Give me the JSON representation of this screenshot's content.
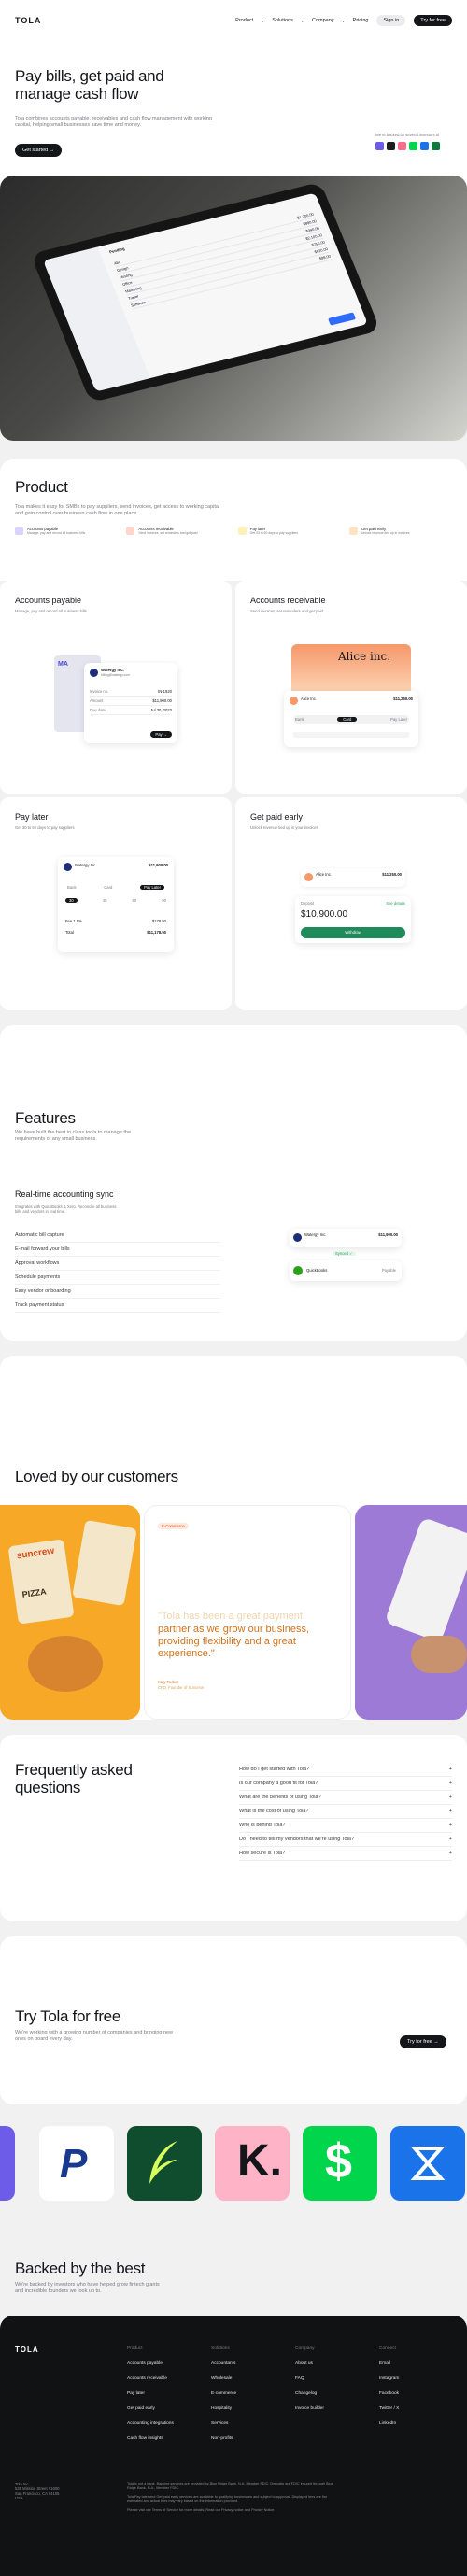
{
  "nav": {
    "logo": "TOLA",
    "links": [
      "Product",
      "Solutions",
      "Company",
      "Pricing"
    ],
    "sign_in": "Sign in",
    "cta": "Try for free"
  },
  "hero": {
    "title": "Pay bills, get paid and manage cash flow",
    "subtitle": "Tola combines accounts payable, receivables and cash flow management with working capital, helping small businesses save time and money.",
    "cta": "Get started",
    "backed": "We're backed by several investors of"
  },
  "dashboard": {
    "tab": "Pending",
    "rows": [
      [
        "Abc",
        "$1,200.00"
      ],
      [
        "Design",
        "$890.00"
      ],
      [
        "Hosting",
        "$340.00"
      ],
      [
        "Office",
        "$2,100.00"
      ],
      [
        "Marketing",
        "$750.00"
      ],
      [
        "Travel",
        "$420.00"
      ],
      [
        "Software",
        "$99.00"
      ]
    ]
  },
  "product": {
    "title": "Product",
    "subtitle": "Tola makes it easy for SMBs to pay suppliers, send invoices, get access to working capital and gain control over business cash flow in one place.",
    "chips": [
      {
        "label": "Accounts payable",
        "desc": "Manage, pay and record all business bills"
      },
      {
        "label": "Accounts receivable",
        "desc": "Send invoices, set reminders and get paid"
      },
      {
        "label": "Pay later",
        "desc": "Get 30 to 60 days to pay suppliers"
      },
      {
        "label": "Get paid early",
        "desc": "Unlock revenue tied up in invoices"
      }
    ],
    "ap": {
      "title": "Accounts payable",
      "desc": "Manage, pay and record all business bills",
      "vendor": "Watergy Inc.",
      "email": "billing@watergy.com",
      "fields": [
        [
          "Invoice no.",
          "IN-1920"
        ],
        [
          "Amount",
          "$11,900.00"
        ],
        [
          "Due date",
          "Jul 30, 2023"
        ]
      ],
      "pay": "Pay"
    },
    "ar": {
      "title": "Accounts receivable",
      "desc": "Send invoices, set reminders and get paid",
      "brand": "Alice inc.",
      "name": "Alice Inc.",
      "amount": "$11,250.00",
      "tabs": [
        "Bank",
        "Card",
        "Pay Later"
      ]
    },
    "pl": {
      "title": "Pay later",
      "desc": "Get 30 to 60 days to pay suppliers",
      "vendor": "Watergy Inc.",
      "amount": "$11,900.00",
      "tabs": [
        "Bank",
        "Card",
        "Pay Later"
      ],
      "days": [
        "30",
        "45",
        "60",
        "90"
      ],
      "fee_label": "Fee 1.5%",
      "fee": "$178.50",
      "total_label": "Total",
      "total": "$11,178.50"
    },
    "gpe": {
      "title": "Get paid early",
      "desc": "Unlock revenue tied up in your invoices",
      "vendor": "Alice Inc.",
      "amount": "$11,250.00",
      "label": "Deposit",
      "value": "$10,900.00",
      "details": "See details",
      "cta": "Withdraw"
    }
  },
  "features": {
    "title": "Features",
    "subtitle": "We have built the best in class tools to manage the requirements of any small business.",
    "sync_title": "Real-time accounting sync",
    "sync_desc": "Integrates with QuickBooks & Xero. Reconcile all business bills and vendors in real time.",
    "list": [
      "Automatic bill capture",
      "E-mail forward your bills",
      "Approval workflows",
      "Schedule payments",
      "Easy vendor onboarding",
      "Track payment status"
    ],
    "vendor": "Watergy Inc.",
    "amount": "$11,900.00",
    "synced": "Synced",
    "qb": "QuickBooks",
    "qb_status": "Payable"
  },
  "testimonials": {
    "title": "Loved by our customers",
    "tag": "E-Commerce",
    "quote_faded": "\"Tola has been a great payment",
    "quote": "partner as we grow our business, providing flexibility and a great experience.\"",
    "name": "Katy Tucker",
    "role": "CFO, Founder of Suncrew",
    "brand": "suncrew",
    "product": "PIZZA"
  },
  "faq": {
    "title": "Frequently asked questions",
    "items": [
      "How do I get started with Tola?",
      "Is our company a good fit for Tola?",
      "What are the benefits of using Tola?",
      "What is the cost of using Tola?",
      "Who is behind Tola?",
      "Do I need to tell my vendors that we're using Tola?",
      "How secure is Tola?"
    ]
  },
  "try": {
    "title": "Try Tola for free",
    "subtitle": "We're working with a growing number of companies and bringing new ones on board every day.",
    "cta": "Try for free"
  },
  "backed": {
    "title": "Backed by the best",
    "subtitle": "We're backed by investors who have helped grow fintech giants and incredible founders we look up to."
  },
  "footer": {
    "logo": "TOLA",
    "cols": [
      {
        "head": "Product",
        "items": [
          "Accounts payable",
          "Accounts receivable",
          "Pay later",
          "Get paid early",
          "Accounting integrations",
          "Cash flow insights"
        ]
      },
      {
        "head": "Solutions",
        "items": [
          "Accountants",
          "Wholesale",
          "E-commerce",
          "Hospitality",
          "Services",
          "Non-profits"
        ]
      },
      {
        "head": "Company",
        "items": [
          "About us",
          "FAQ",
          "Changelog",
          "Invoice builder"
        ]
      },
      {
        "head": "Connect",
        "items": [
          "Email",
          "Instagram",
          "Facebook",
          "Twitter / X",
          "LinkedIn"
        ]
      }
    ],
    "address": "Tola Inc.\n535 Mission Street #1600\nSan Francisco, CA 94105\nUSA",
    "legal": "Tola is not a bank. Banking services are provided by Blue Ridge Bank, N.A. Member FDIC. Deposits are FDIC insured through Blue Ridge Bank, N.A., Member FDIC.",
    "legal2": "Tola Pay later and Get paid early services are available to qualifying businesses and subject to approval. Displayed fees are the estimated and actual fees may vary based on the information provided.",
    "legal3": "Please visit our Terms of Service for more details. Read our Privacy notice and Privacy Notice."
  }
}
